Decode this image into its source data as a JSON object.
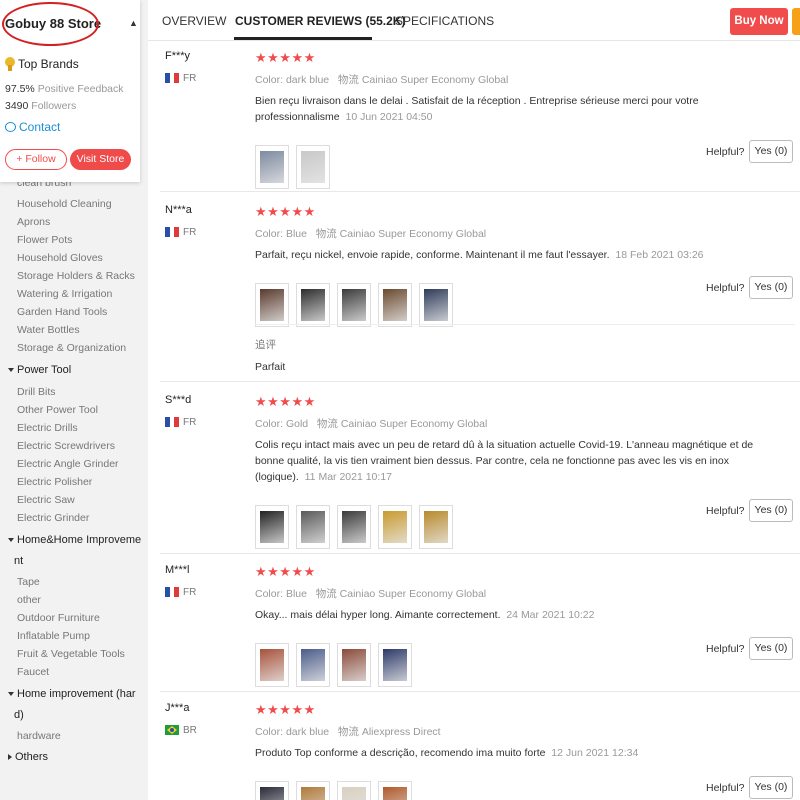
{
  "store": {
    "name": "Gobuy 88 Store",
    "badge": "Top Brands",
    "feedback_value": "97.5%",
    "feedback_label": "Positive Feedback",
    "followers_value": "3490",
    "followers_label": "Followers",
    "contact": "Contact",
    "follow": "+ Follow",
    "visit": "Visit Store"
  },
  "categories": {
    "cut_item": "clean brush",
    "garden_items": [
      "Household Cleaning",
      "Aprons",
      "Flower Pots",
      "Household Gloves",
      "Storage Holders & Racks",
      "Watering & Irrigation",
      "Garden Hand Tools",
      "Water Bottles",
      "Storage & Organization"
    ],
    "power_tool": {
      "label": "Power Tool",
      "items": [
        "Drill Bits",
        "Other Power Tool",
        "Electric Drills",
        "Electric Screwdrivers",
        "Electric Angle Grinder",
        "Electric Polisher",
        "Electric Saw",
        "Electric Grinder"
      ]
    },
    "home_improvement": {
      "label_line1": "Home&Home Improveme",
      "label_line2": "nt",
      "items": [
        "Tape",
        "other",
        "Outdoor Furniture",
        "Inflatable Pump",
        "Fruit & Vegetable Tools",
        "Faucet"
      ]
    },
    "home_improvement_hard": {
      "label_line1": "Home improvement (har",
      "label_line2": "d)",
      "items": [
        "hardware"
      ]
    },
    "others": "Others"
  },
  "tabs": {
    "overview": "OVERVIEW",
    "reviews": "CUSTOMER REVIEWS (55.2K)",
    "specs": "SPECIFICATIONS",
    "buy_now": "Buy Now"
  },
  "labels": {
    "color": "Color:",
    "logistics": "物流",
    "helpful": "Helpful?",
    "yes": "Yes (0)",
    "followup": "追评"
  },
  "reviews": [
    {
      "user": "F***y",
      "country": "FR",
      "stars": "★★★★★",
      "color": "dark blue",
      "shipping": "Cainiao Super Economy Global",
      "text": "Bien reçu livraison dans le delai . Satisfait de la réception . Entreprise sérieuse merci pour votre professionnalisme",
      "date": "10 Jun 2021 04:50"
    },
    {
      "user": "N***a",
      "country": "FR",
      "stars": "★★★★★",
      "color": "Blue",
      "shipping": "Cainiao Super Economy Global",
      "text": "Parfait, reçu nickel, envoie rapide, conforme. Maintenant il me faut l'essayer.",
      "date": "18 Feb 2021 03:26",
      "followup": "Parfait"
    },
    {
      "user": "S***d",
      "country": "FR",
      "stars": "★★★★★",
      "color": "Gold",
      "shipping": "Cainiao Super Economy Global",
      "text": "Colis reçu intact mais avec un peu de retard dû à la situation actuelle Covid-19. L'anneau magnétique et de bonne qualité, la vis tien vraiment bien dessus. Par contre, cela ne fonctionne pas avec les vis en inox (logique).",
      "date": "11 Mar 2021 10:17"
    },
    {
      "user": "M***l",
      "country": "FR",
      "stars": "★★★★★",
      "color": "Blue",
      "shipping": "Cainiao Super Economy Global",
      "text": "Okay... mais délai hyper long. Aimante correctement.",
      "date": "24 Mar 2021 10:22"
    },
    {
      "user": "J***a",
      "country": "BR",
      "stars": "★★★★★",
      "color": "dark blue",
      "shipping": "Aliexpress Direct",
      "text": "Produto Top conforme a descrição, recomendo ima muito forte",
      "date": "12 Jun 2021 12:34"
    }
  ],
  "colors": {
    "accent": "#f04c4c",
    "link": "#1a8fd8",
    "annotation": "#d32020",
    "cart": "#f7a019"
  }
}
